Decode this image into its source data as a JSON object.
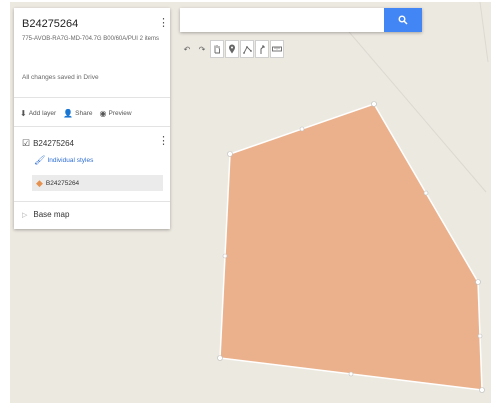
{
  "map_title": "B24275264",
  "map_description": "775-AVOB-RA7G-MD-704.7G B00/60A/PUI 2 items",
  "save_status": "All changes saved in Drive",
  "panel_tools": {
    "add_layer": "Add layer",
    "share": "Share",
    "preview": "Preview"
  },
  "layer": {
    "name": "B24275264",
    "style_link": "Individual styles",
    "feature_name": "B24275264"
  },
  "base_map_label": "Base map",
  "search": {
    "value": "",
    "placeholder": ""
  },
  "toolbar_icons": [
    "undo-icon",
    "redo-icon",
    "hand-icon",
    "marker-icon",
    "draw-line-icon",
    "route-icon",
    "ruler-icon"
  ],
  "colors": {
    "polygon_fill": "#EBB18C",
    "polygon_stroke": "#FFFFFF",
    "accent": "#4285F4",
    "feature_icon": "#E5914F",
    "map_background": "#ECE9E1"
  }
}
